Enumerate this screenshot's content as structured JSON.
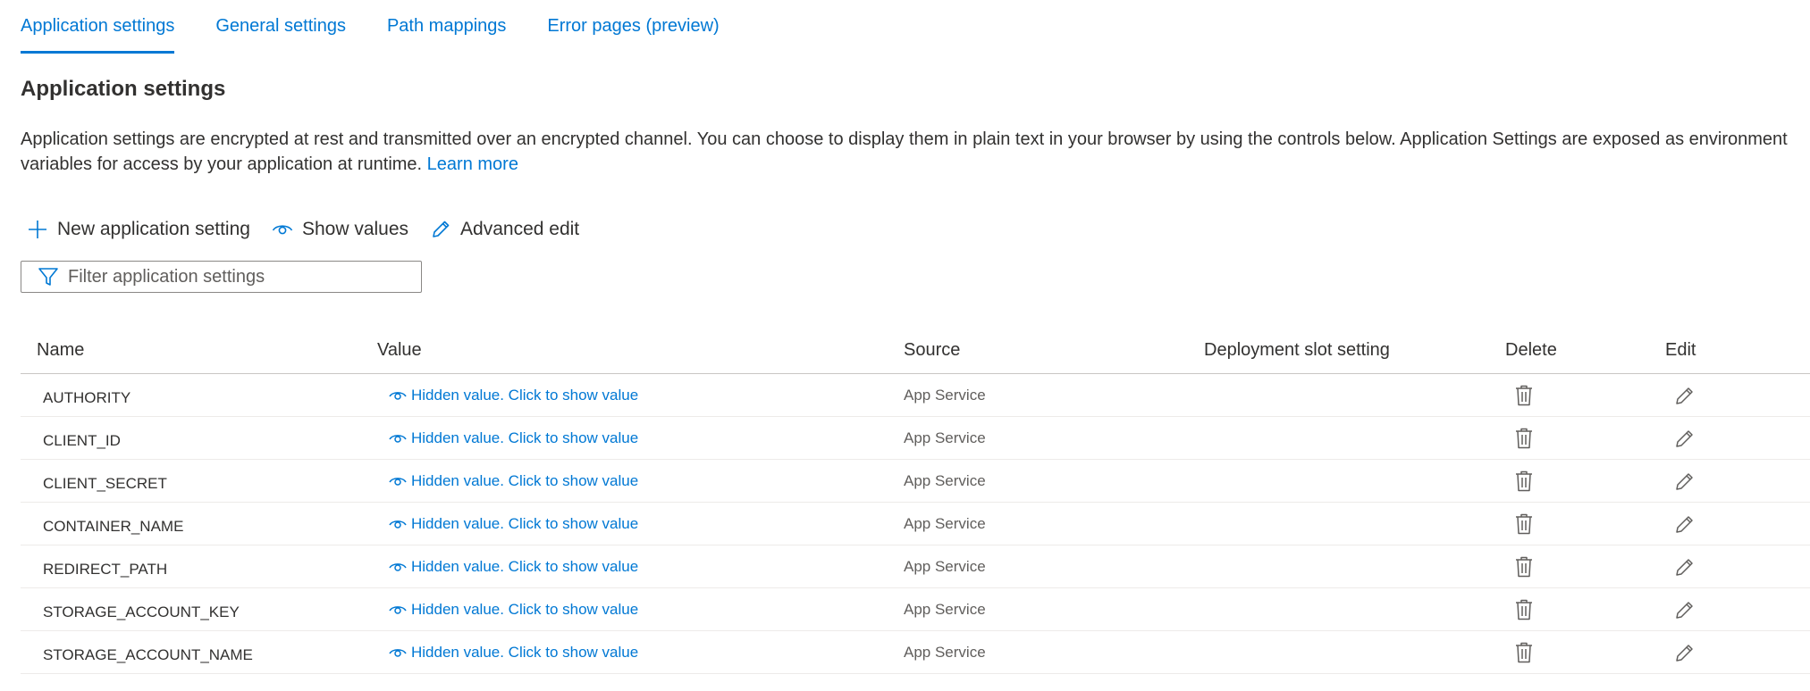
{
  "tabs": [
    {
      "label": "Application settings"
    },
    {
      "label": "General settings"
    },
    {
      "label": "Path mappings"
    },
    {
      "label": "Error pages (preview)"
    }
  ],
  "page": {
    "title": "Application settings",
    "description": "Application settings are encrypted at rest and transmitted over an encrypted channel. You can choose to display them in plain text in your browser by using the controls below. Application Settings are exposed as environment variables for access by your application at runtime.",
    "learn_more": "Learn more"
  },
  "toolbar": {
    "new_label": "New application setting",
    "show_label": "Show values",
    "advanced_label": "Advanced edit"
  },
  "filter": {
    "placeholder": "Filter application settings",
    "value": ""
  },
  "table": {
    "headers": {
      "name": "Name",
      "value": "Value",
      "source": "Source",
      "slot": "Deployment slot setting",
      "delete": "Delete",
      "edit": "Edit"
    },
    "rows": [
      {
        "name": "AUTHORITY",
        "value": "Hidden value. Click to show value",
        "source": "App Service"
      },
      {
        "name": "CLIENT_ID",
        "value": "Hidden value. Click to show value",
        "source": "App Service"
      },
      {
        "name": "CLIENT_SECRET",
        "value": "Hidden value. Click to show value",
        "source": "App Service"
      },
      {
        "name": "CONTAINER_NAME",
        "value": "Hidden value. Click to show value",
        "source": "App Service"
      },
      {
        "name": "REDIRECT_PATH",
        "value": "Hidden value. Click to show value",
        "source": "App Service"
      },
      {
        "name": "STORAGE_ACCOUNT_KEY",
        "value": "Hidden value. Click to show value",
        "source": "App Service"
      },
      {
        "name": "STORAGE_ACCOUNT_NAME",
        "value": "Hidden value. Click to show value",
        "source": "App Service"
      }
    ]
  },
  "colors": {
    "accent": "#0078d4",
    "text": "#323130",
    "muted": "#605e5c"
  }
}
